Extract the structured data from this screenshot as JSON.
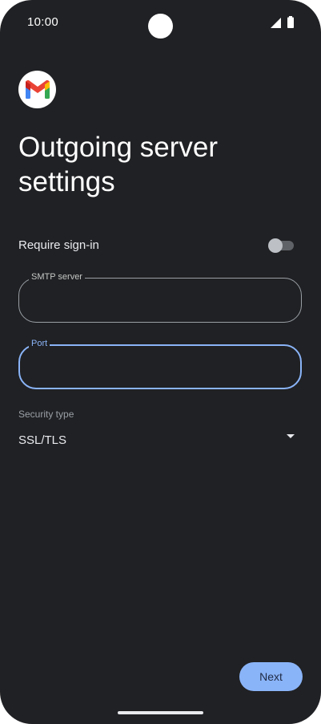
{
  "status_bar": {
    "time": "10:00",
    "signal_icon": "cellular-signal-icon",
    "battery_icon": "battery-icon"
  },
  "app": {
    "logo_icon": "gmail-logo-icon"
  },
  "page": {
    "title": "Outgoing server settings"
  },
  "require_signin": {
    "label": "Require sign-in",
    "enabled": false
  },
  "smtp_server": {
    "label": "SMTP server",
    "value": ""
  },
  "port": {
    "label": "Port",
    "value": "",
    "focused": true
  },
  "security_type": {
    "label": "Security type",
    "value": "SSL/TLS",
    "icon": "dropdown-arrow-icon"
  },
  "actions": {
    "next_label": "Next"
  },
  "colors": {
    "background": "#202124",
    "accent": "#8ab4f8",
    "outline": "#9aa0a6"
  }
}
